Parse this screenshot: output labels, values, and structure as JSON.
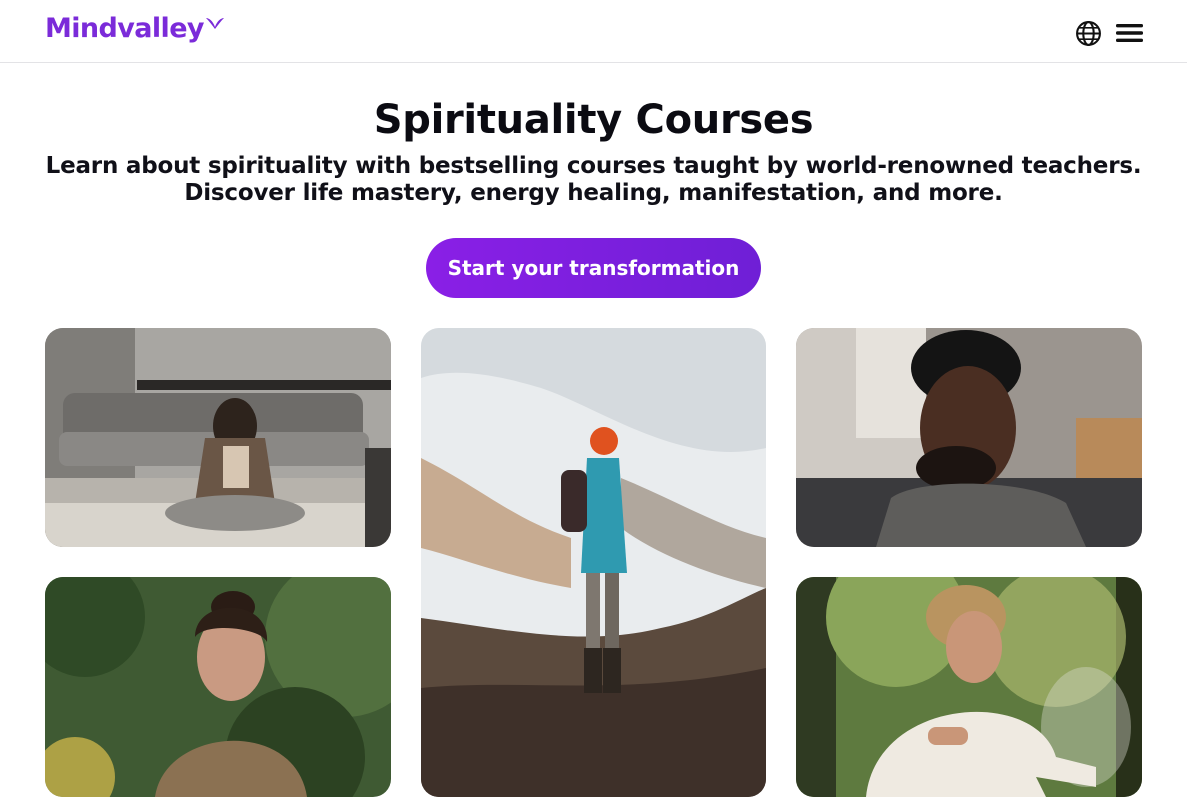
{
  "header": {
    "logo_text": "Mindvalley",
    "brand_color": "#7b2bd9",
    "icons": [
      "globe-icon",
      "menu-icon"
    ]
  },
  "hero": {
    "title": "Spirituality Courses",
    "subtitle_line1": "Learn about spirituality with bestselling courses taught by world-renowned teachers.",
    "subtitle_line2": "Discover life mastery, energy healing, manifestation, and more.",
    "cta_label": "Start your transformation",
    "cta_color": "#8a1fe6"
  },
  "gallery": {
    "images": [
      "woman-meditating-living-room-photo",
      "hiker-snowy-mountain-photo",
      "man-eyes-closed-photo",
      "woman-in-forest-photo",
      "man-breathing-in-forest-photo"
    ]
  }
}
